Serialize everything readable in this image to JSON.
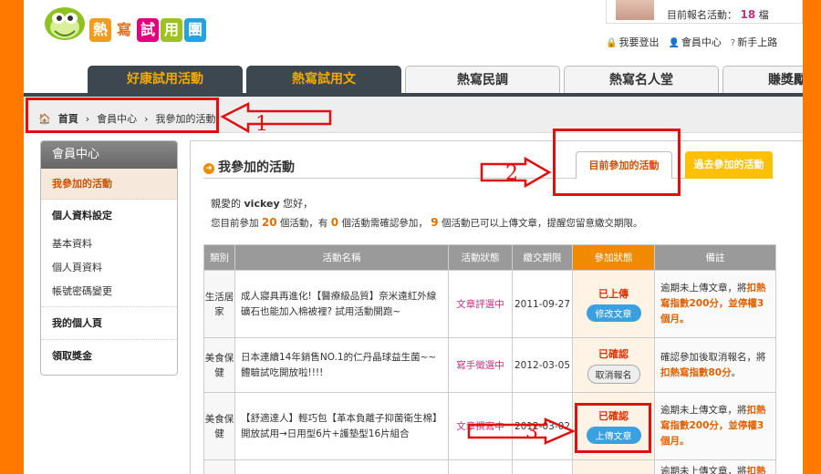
{
  "logo": {
    "chars": [
      "熱",
      "寫",
      "試",
      "用",
      "團"
    ],
    "colors": [
      "#f29c1f",
      "#ec6a1b",
      "#e3007f",
      "#9cc31f",
      "#25a2e0"
    ]
  },
  "user": {
    "count_label": "目前報名活動：",
    "count": "18",
    "count_unit": "檔"
  },
  "toplinks": [
    {
      "icon": "lock-icon",
      "label": "我要登出"
    },
    {
      "icon": "person-icon",
      "label": "會員中心"
    },
    {
      "icon": "help-icon",
      "label": "新手上路"
    }
  ],
  "tabs": [
    "好康試用活動",
    "熱寫試用文",
    "熱寫民調",
    "熱寫名人堂",
    "賺獎勵秘技"
  ],
  "breadcrumb": {
    "home": "首頁",
    "items": [
      "會員中心",
      "我參加的活動"
    ]
  },
  "sidebar": {
    "title": "會員中心",
    "active": "我參加的活動",
    "section1": "個人資料設定",
    "subs": [
      "基本資料",
      "個人頁資料",
      "帳號密碼變更"
    ],
    "section2": "我的個人頁",
    "section3": "領取獎金"
  },
  "main": {
    "title": "我參加的活動",
    "tab_current": "目前參加的活動",
    "tab_past": "過去參加的活動",
    "greet_pre": "親愛的",
    "username": "vickey",
    "greet_post": "您好，",
    "summary": {
      "p1": "您目前參加",
      "n1": "20",
      "p2": "個活動，有",
      "n2": "0",
      "p3": "個活動需確認參加，",
      "n3": "9",
      "p4": "個活動已可以上傳文章，提醒您留意繳交期限。"
    }
  },
  "table": {
    "headers": [
      "類別",
      "活動名稱",
      "活動狀態",
      "繳交期限",
      "參加狀態",
      "備註"
    ],
    "rows": [
      {
        "cat": "生活居家",
        "name": "成人寢具再進化!【醫療級品質】奈米遠紅外線礦石也能加入棉被裡? 試用活動開跑~",
        "status": "文章評選中",
        "date": "2011-09-27",
        "join": "已上傳",
        "button": "修改文章",
        "note_pre": "逾期未上傳文章，將",
        "note_hl": "扣熱寫指數200分，並停權3個月。",
        "note_post": ""
      },
      {
        "cat": "美食保健",
        "name": "日本連續14年銷售NO.1的仁丹晶球益生菌~~體驗試吃開放啦!!!!",
        "status": "寫手徵選中",
        "date": "2012-03-05",
        "join": "已確認",
        "button": "取消報名",
        "note_pre": "確認參加後取消報名，將",
        "note_hl": "扣熱寫指數80分",
        "note_post": "。"
      },
      {
        "cat": "美食保健",
        "name": "【舒適達人】輕巧包【革本負離子抑菌衛生棉】開放試用→日用型6片+護墊型16片組合",
        "status": "文章撰寫中",
        "date": "2012-03-02",
        "join": "已確認",
        "button": "上傳文章",
        "note_pre": "逾期未上傳文章，將",
        "note_hl": "扣熱寫指數200分，並停權3個月。",
        "note_post": ""
      },
      {
        "cat": "",
        "name": "",
        "status": "",
        "date": "",
        "join": "",
        "button": "",
        "note_pre": "逾期未上傳文章，將",
        "note_hl": "扣熱",
        "note_post": ""
      }
    ]
  },
  "annotations": [
    "1",
    "2",
    "3"
  ],
  "colors": {
    "frame": "#ff7800",
    "nav_dark": "#3d4750",
    "accent": "#f08a00",
    "annotation_red": "#e01010"
  }
}
